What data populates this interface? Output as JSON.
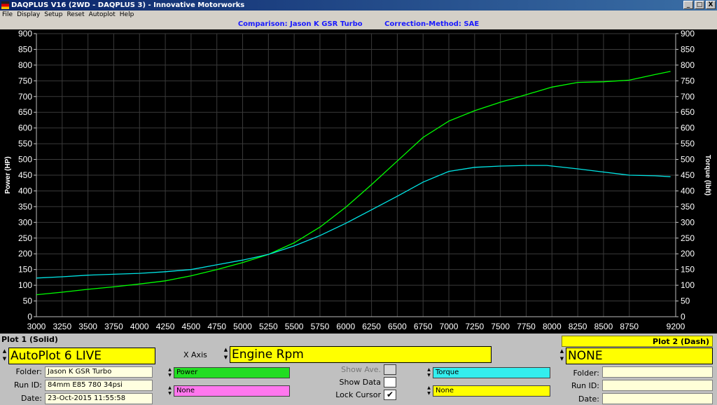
{
  "window": {
    "title": "DAQPLUS V16 (2WD - DAQPLUS 3) - Innovative Motorworks",
    "buttons": [
      "_",
      "□",
      "X"
    ]
  },
  "menu": [
    "File",
    "Display",
    "Setup",
    "Reset",
    "Autoplot",
    "Help"
  ],
  "header": {
    "comparison": "Comparison: Jason K GSR Turbo",
    "correction": "Correction-Method: SAE"
  },
  "chart_data": {
    "type": "line",
    "xlim": [
      3000,
      9200
    ],
    "ylim": [
      0,
      900
    ],
    "x_ticks": [
      "3000",
      "3250",
      "3500",
      "3750",
      "4000",
      "4250",
      "4500",
      "4750",
      "5000",
      "5250",
      "5500",
      "5750",
      "6000",
      "6250",
      "6500",
      "6750",
      "7000",
      "7250",
      "7500",
      "7750",
      "8000",
      "8250",
      "8500",
      "8750",
      "9200"
    ],
    "y_ticks": [
      "0",
      "50",
      "100",
      "150",
      "200",
      "250",
      "300",
      "350",
      "400",
      "450",
      "500",
      "550",
      "600",
      "650",
      "700",
      "750",
      "800",
      "850",
      "900"
    ],
    "ylabel_left": "Power (HP)",
    "ylabel_right": "Torque (lbft)",
    "grid": true,
    "series": [
      {
        "name": "Power",
        "color": "#00ff00",
        "points": [
          [
            3000,
            70
          ],
          [
            3250,
            78
          ],
          [
            3500,
            87
          ],
          [
            3750,
            95
          ],
          [
            4000,
            104
          ],
          [
            4250,
            114
          ],
          [
            4500,
            130
          ],
          [
            4750,
            150
          ],
          [
            5000,
            172
          ],
          [
            5250,
            198
          ],
          [
            5500,
            235
          ],
          [
            5750,
            285
          ],
          [
            6000,
            348
          ],
          [
            6250,
            420
          ],
          [
            6500,
            495
          ],
          [
            6750,
            570
          ],
          [
            7000,
            622
          ],
          [
            7250,
            655
          ],
          [
            7500,
            682
          ],
          [
            7750,
            706
          ],
          [
            8000,
            730
          ],
          [
            8250,
            745
          ],
          [
            8500,
            747
          ],
          [
            8750,
            752
          ],
          [
            9000,
            770
          ],
          [
            9150,
            780
          ]
        ]
      },
      {
        "name": "Torque",
        "color": "#00e5e5",
        "points": [
          [
            3000,
            123
          ],
          [
            3250,
            127
          ],
          [
            3500,
            132
          ],
          [
            3750,
            135
          ],
          [
            4000,
            138
          ],
          [
            4250,
            143
          ],
          [
            4500,
            150
          ],
          [
            4750,
            165
          ],
          [
            5000,
            180
          ],
          [
            5250,
            198
          ],
          [
            5500,
            225
          ],
          [
            5750,
            258
          ],
          [
            6000,
            297
          ],
          [
            6250,
            340
          ],
          [
            6500,
            383
          ],
          [
            6750,
            428
          ],
          [
            7000,
            462
          ],
          [
            7250,
            475
          ],
          [
            7500,
            479
          ],
          [
            7750,
            481
          ],
          [
            7950,
            481
          ],
          [
            8250,
            470
          ],
          [
            8500,
            460
          ],
          [
            8750,
            450
          ],
          [
            9000,
            448
          ],
          [
            9150,
            445
          ]
        ]
      }
    ]
  },
  "plot1": {
    "label": "Plot 1 (Solid)",
    "name": "AutoPlot 6 LIVE",
    "folder_label": "Folder:",
    "folder": "Jason K GSR Turbo",
    "run_label": "Run ID:",
    "run": "84mm E85 780 34psi",
    "date_label": "Date:",
    "date": "23-Oct-2015 11:55:58",
    "sel1": "Power",
    "sel2": "None",
    "sel1_color": "#22dd22",
    "sel2_color": "#ff77ee"
  },
  "xaxis": {
    "label": "X Axis",
    "value": "Engine Rpm"
  },
  "options": {
    "show_ave": "Show Ave.",
    "show_data": "Show Data",
    "lock_cursor": "Lock Cursor",
    "lock_mark": "✔"
  },
  "plot2": {
    "label": "Plot 2 (Dash)",
    "name": "NONE",
    "folder_label": "Folder:",
    "run_label": "Run ID:",
    "date_label": "Date:",
    "sel1": "Torque",
    "sel2": "None",
    "sel1_color": "#33eeee",
    "sel2_color": "#ffff00"
  }
}
